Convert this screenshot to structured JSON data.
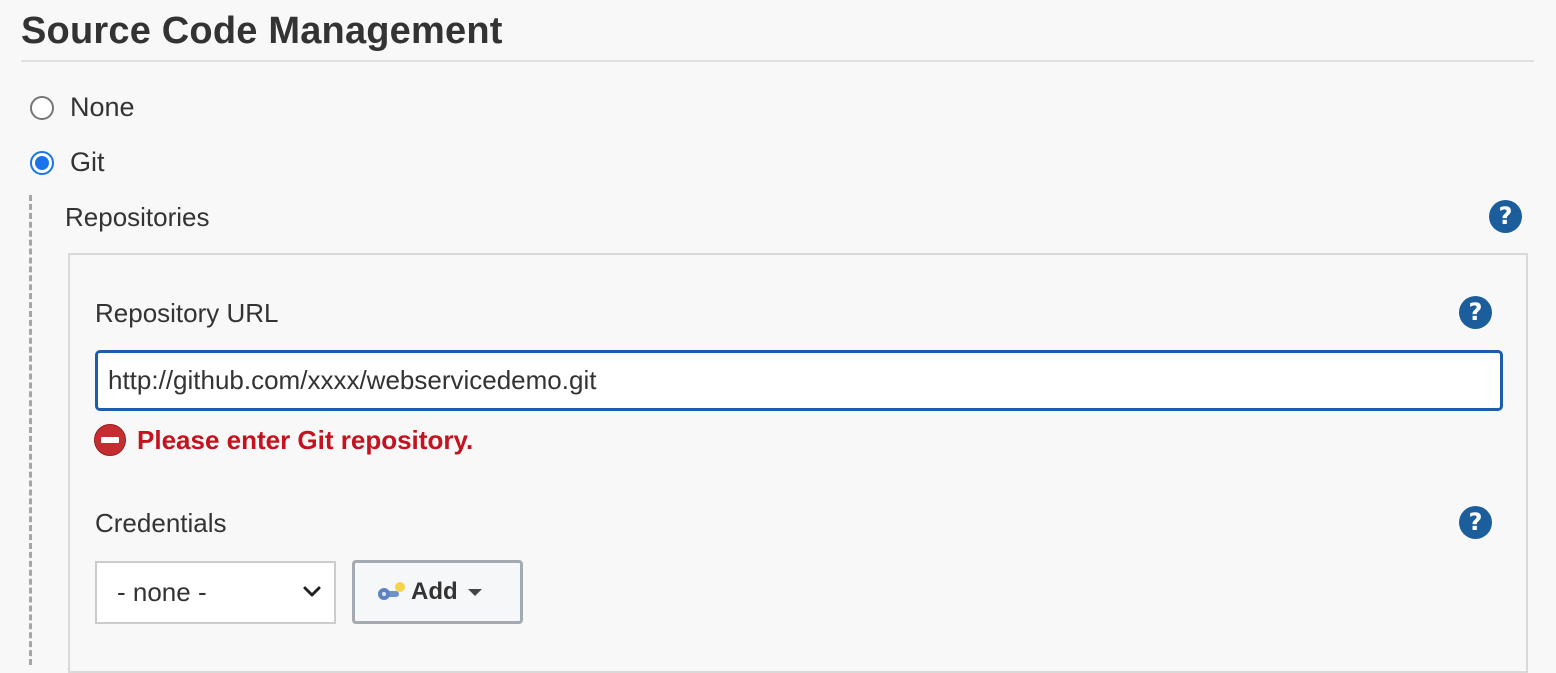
{
  "section": {
    "title": "Source Code Management"
  },
  "scm_options": [
    {
      "label": "None",
      "selected": false
    },
    {
      "label": "Git",
      "selected": true
    }
  ],
  "repositories": {
    "heading": "Repositories",
    "help_icon": "question-circle-icon"
  },
  "repository_url": {
    "label": "Repository URL",
    "value": "http://github.com/xxxx/webservicedemo.git",
    "error": "Please enter Git repository."
  },
  "credentials": {
    "label": "Credentials",
    "selected": "- none -",
    "add_label": "Add"
  },
  "colors": {
    "accent": "#1a73e8",
    "help": "#1b5e9b",
    "error": "#c4121e",
    "input_border": "#1b5fab"
  }
}
